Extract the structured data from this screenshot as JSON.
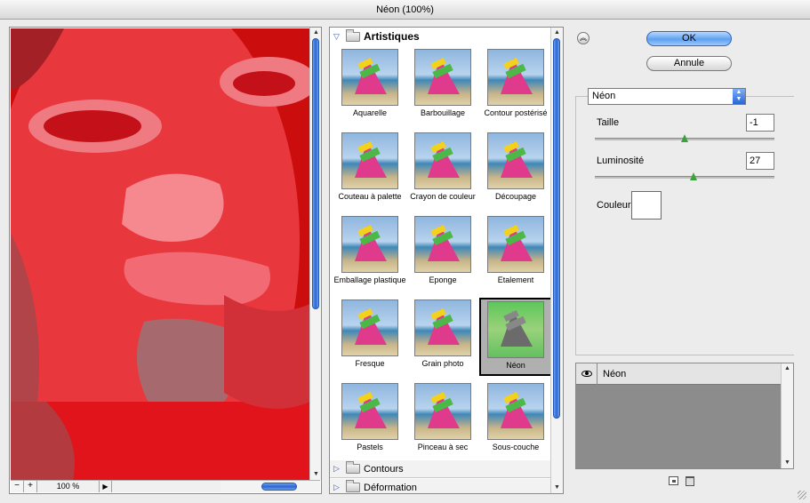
{
  "window": {
    "title": "Néon (100%)"
  },
  "preview": {
    "zoom_minus": "−",
    "zoom_plus": "+",
    "zoom_level": "100 %",
    "zoom_menu": "▶"
  },
  "gallery": {
    "open_category": "Artistiques",
    "filters": [
      "Aquarelle",
      "Barbouillage",
      "Contour postérisé",
      "Couteau à palette",
      "Crayon de couleur",
      "Découpage",
      "Emballage plastique",
      "Eponge",
      "Etalement",
      "Fresque",
      "Grain photo",
      "Néon",
      "Pastels",
      "Pinceau à sec",
      "Sous-couche"
    ],
    "selected_filter": "Néon",
    "closed_categories": [
      "Contours",
      "Déformation"
    ]
  },
  "buttons": {
    "ok": "OK",
    "cancel": "Annule"
  },
  "settings": {
    "filter_select": "Néon",
    "size_label": "Taille",
    "size_value": "-1",
    "size_slider": 0.5,
    "brightness_label": "Luminosité",
    "brightness_value": "27",
    "brightness_slider": 0.55,
    "color_label": "Couleur",
    "color_value": "#ffffff"
  },
  "layers": {
    "items": [
      {
        "name": "Néon"
      }
    ]
  },
  "colors": {
    "accent": "#2a66d6",
    "preview_red": "#d01010"
  }
}
